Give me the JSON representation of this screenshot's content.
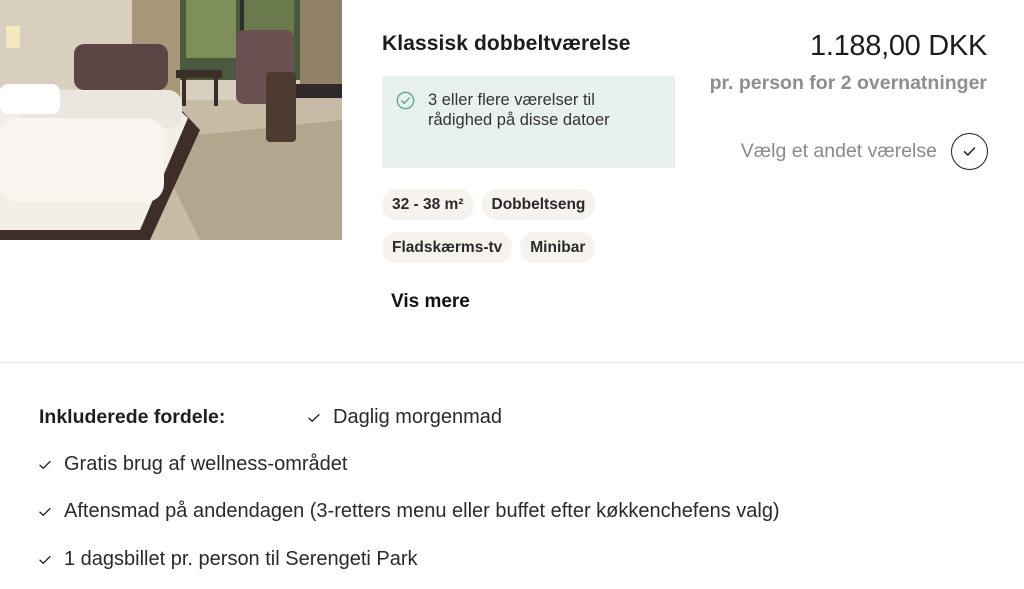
{
  "room": {
    "title": "Klassisk dobbeltværelse",
    "availability": "3 eller flere værelser til rådighed på disse datoer",
    "features": [
      [
        "32 - 38 m²",
        "Dobbeltseng"
      ],
      [
        "Fladskærms-tv",
        "Minibar"
      ]
    ],
    "show_more": "Vis mere"
  },
  "pricing": {
    "price": "1.188,00 DKK",
    "subtitle": "pr. person for 2 overnatninger",
    "select_label": "Vælg et andet værelse"
  },
  "benefits": {
    "heading": "Inkluderede fordele:",
    "items": [
      "Daglig morgenmad",
      "Gratis brug af wellness-området",
      "Aftensmad på andendagen (3-retters menu eller buffet efter køkkenchefens valg)",
      "1 dagsbillet pr. person til Serengeti Park"
    ]
  },
  "colors": {
    "availability_bg": "#e8f1ef",
    "availability_icon": "#5fa88f",
    "chip_bg": "#f6f2ee",
    "muted_text": "#8e8e8e"
  },
  "icons": {
    "availability": "check-circle-icon",
    "select": "check-icon",
    "benefit": "check-icon"
  }
}
